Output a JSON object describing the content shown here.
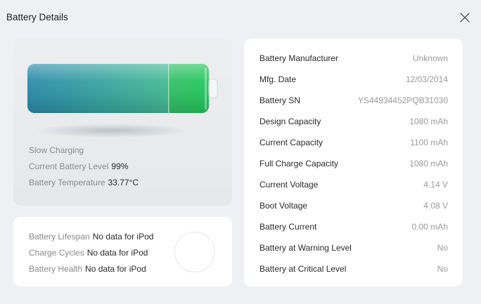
{
  "window": {
    "title": "Battery Details"
  },
  "battery": {
    "fill_fraction": 0.99,
    "charging_status": "Slow Charging",
    "level_label": "Current Battery Level",
    "level_value": "99%",
    "temp_label": "Battery Temperature",
    "temp_value": "33.77°C",
    "colors": {
      "start": "#2a8fae",
      "mid": "#36b38a",
      "end": "#2fcf6a"
    }
  },
  "lifespan": {
    "rows": [
      {
        "label": "Battery Lifespan",
        "value": "No data for iPod"
      },
      {
        "label": "Charge Cycles",
        "value": "No data for iPod"
      },
      {
        "label": "Battery Health",
        "value": "No data for iPod"
      }
    ]
  },
  "details": {
    "rows": [
      {
        "label": "Battery Manufacturer",
        "value": "Unknown"
      },
      {
        "label": "Mfg. Date",
        "value": "12/03/2014"
      },
      {
        "label": "Battery SN",
        "value": "YS44934452PQB31030"
      },
      {
        "label": "Design Capacity",
        "value": "1080 mAh"
      },
      {
        "label": "Current Capacity",
        "value": "1100 mAh"
      },
      {
        "label": "Full Charge Capacity",
        "value": "1080 mAh"
      },
      {
        "label": "Current Voltage",
        "value": "4.14 V"
      },
      {
        "label": "Boot Voltage",
        "value": "4.08 V"
      },
      {
        "label": "Battery Current",
        "value": "0.00 mAh"
      },
      {
        "label": "Battery at Warning Level",
        "value": "No"
      },
      {
        "label": "Battery at Critical Level",
        "value": "No"
      }
    ]
  },
  "icons": {
    "close": "close-icon",
    "battery": "battery-icon"
  }
}
